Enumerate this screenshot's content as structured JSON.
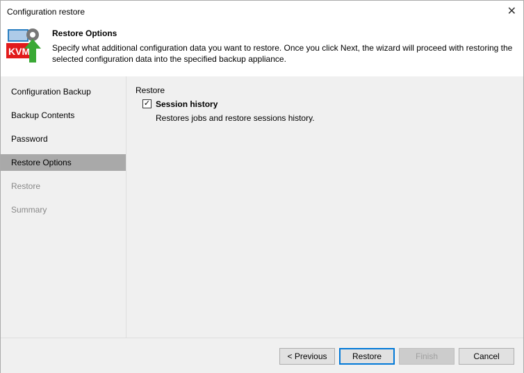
{
  "window": {
    "title": "Configuration restore"
  },
  "header": {
    "title": "Restore Options",
    "description": "Specify what additional configuration data you want to restore. Once you click Next, the wizard will proceed with restoring the selected configuration data into the specified backup appliance.",
    "icon_text": "KVM"
  },
  "sidebar": {
    "items": [
      {
        "label": "Configuration Backup",
        "state": "normal"
      },
      {
        "label": "Backup Contents",
        "state": "normal"
      },
      {
        "label": "Password",
        "state": "normal"
      },
      {
        "label": "Restore Options",
        "state": "active"
      },
      {
        "label": "Restore",
        "state": "disabled"
      },
      {
        "label": "Summary",
        "state": "disabled"
      }
    ]
  },
  "main": {
    "group_label": "Restore",
    "option_label": "Session history",
    "option_checked": true,
    "option_description": "Restores jobs and restore sessions history."
  },
  "footer": {
    "previous": "< Previous",
    "restore": "Restore",
    "finish": "Finish",
    "cancel": "Cancel"
  }
}
